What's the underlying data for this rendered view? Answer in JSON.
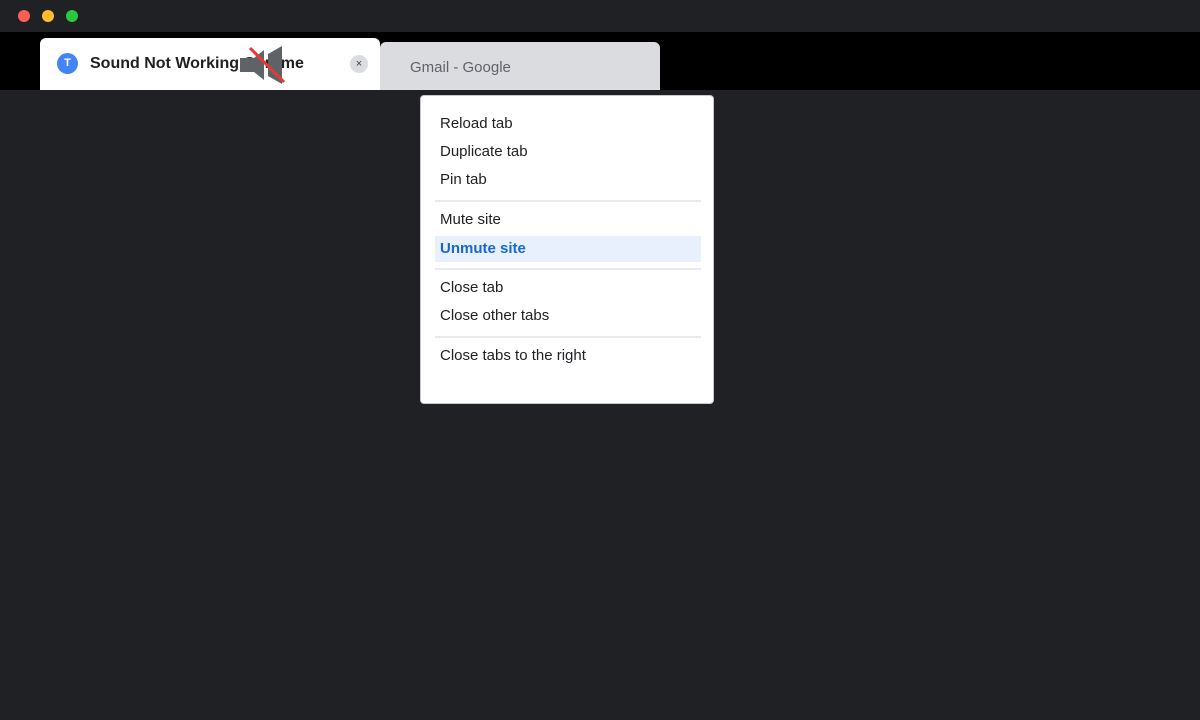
{
  "window": {
    "controls": [
      "close",
      "minimize",
      "maximize"
    ]
  },
  "tabs": {
    "active": {
      "favicon_letter": "T",
      "title": "Sound Not Working Chrome",
      "muted": true,
      "close_label": "×"
    },
    "inactive": {
      "title": "Gmail - Google"
    }
  },
  "context_menu": {
    "items": [
      {
        "label": "Reload tab"
      },
      {
        "label": "Duplicate tab"
      },
      {
        "label": "Pin tab"
      },
      {
        "label": "Mute site"
      },
      {
        "label": "Unmute site",
        "highlighted": true
      },
      {
        "label": "Close tab"
      },
      {
        "label": "Close other tabs"
      },
      {
        "label": "Close tabs to the right"
      }
    ]
  },
  "colors": {
    "highlight_bg": "#e8f0fe",
    "highlight_text": "#1967d2",
    "favicon": "#4285f4",
    "mute_slash": "#e53935"
  },
  "icons": {
    "mute": "speaker-muted-icon",
    "close": "close-icon"
  }
}
